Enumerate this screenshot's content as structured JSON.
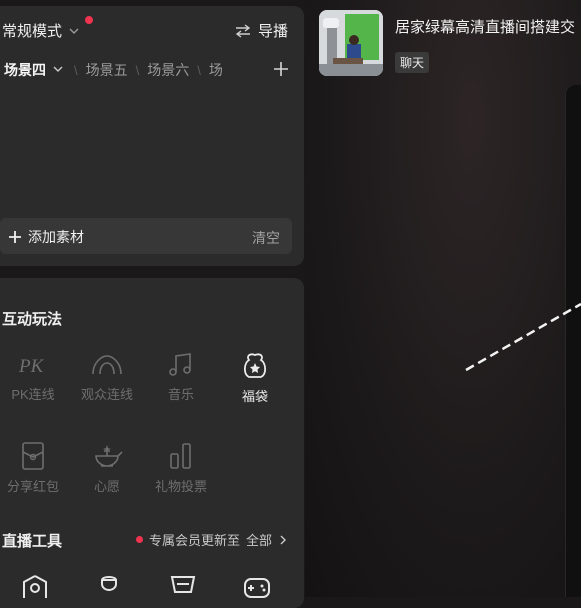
{
  "header": {
    "mode_label": "常规模式",
    "guide_label": "导播"
  },
  "scenes": {
    "active": "场景四",
    "items": [
      "场景五",
      "场景六",
      "场"
    ]
  },
  "materials": {
    "add_label": "添加素材",
    "clear_label": "清空"
  },
  "interactive": {
    "title": "互动玩法",
    "items": [
      {
        "label": "PK连线",
        "icon": "pk-icon"
      },
      {
        "label": "观众连线",
        "icon": "audience-link-icon"
      },
      {
        "label": "音乐",
        "icon": "music-icon"
      },
      {
        "label": "福袋",
        "icon": "lucky-bag-icon"
      },
      {
        "label": "分享红包",
        "icon": "red-envelope-icon"
      },
      {
        "label": "心愿",
        "icon": "wish-lamp-icon"
      },
      {
        "label": "礼物投票",
        "icon": "gift-vote-icon"
      }
    ]
  },
  "tools": {
    "title": "直播工具",
    "promo": "专属会员更新至",
    "all_label": "全部"
  },
  "live": {
    "title": "居家绿幕高清直播间搭建交",
    "tag": "聊天"
  },
  "colors": {
    "accent": "#f0334f",
    "panel": "#2b2b2b",
    "background": "#1a1819"
  }
}
